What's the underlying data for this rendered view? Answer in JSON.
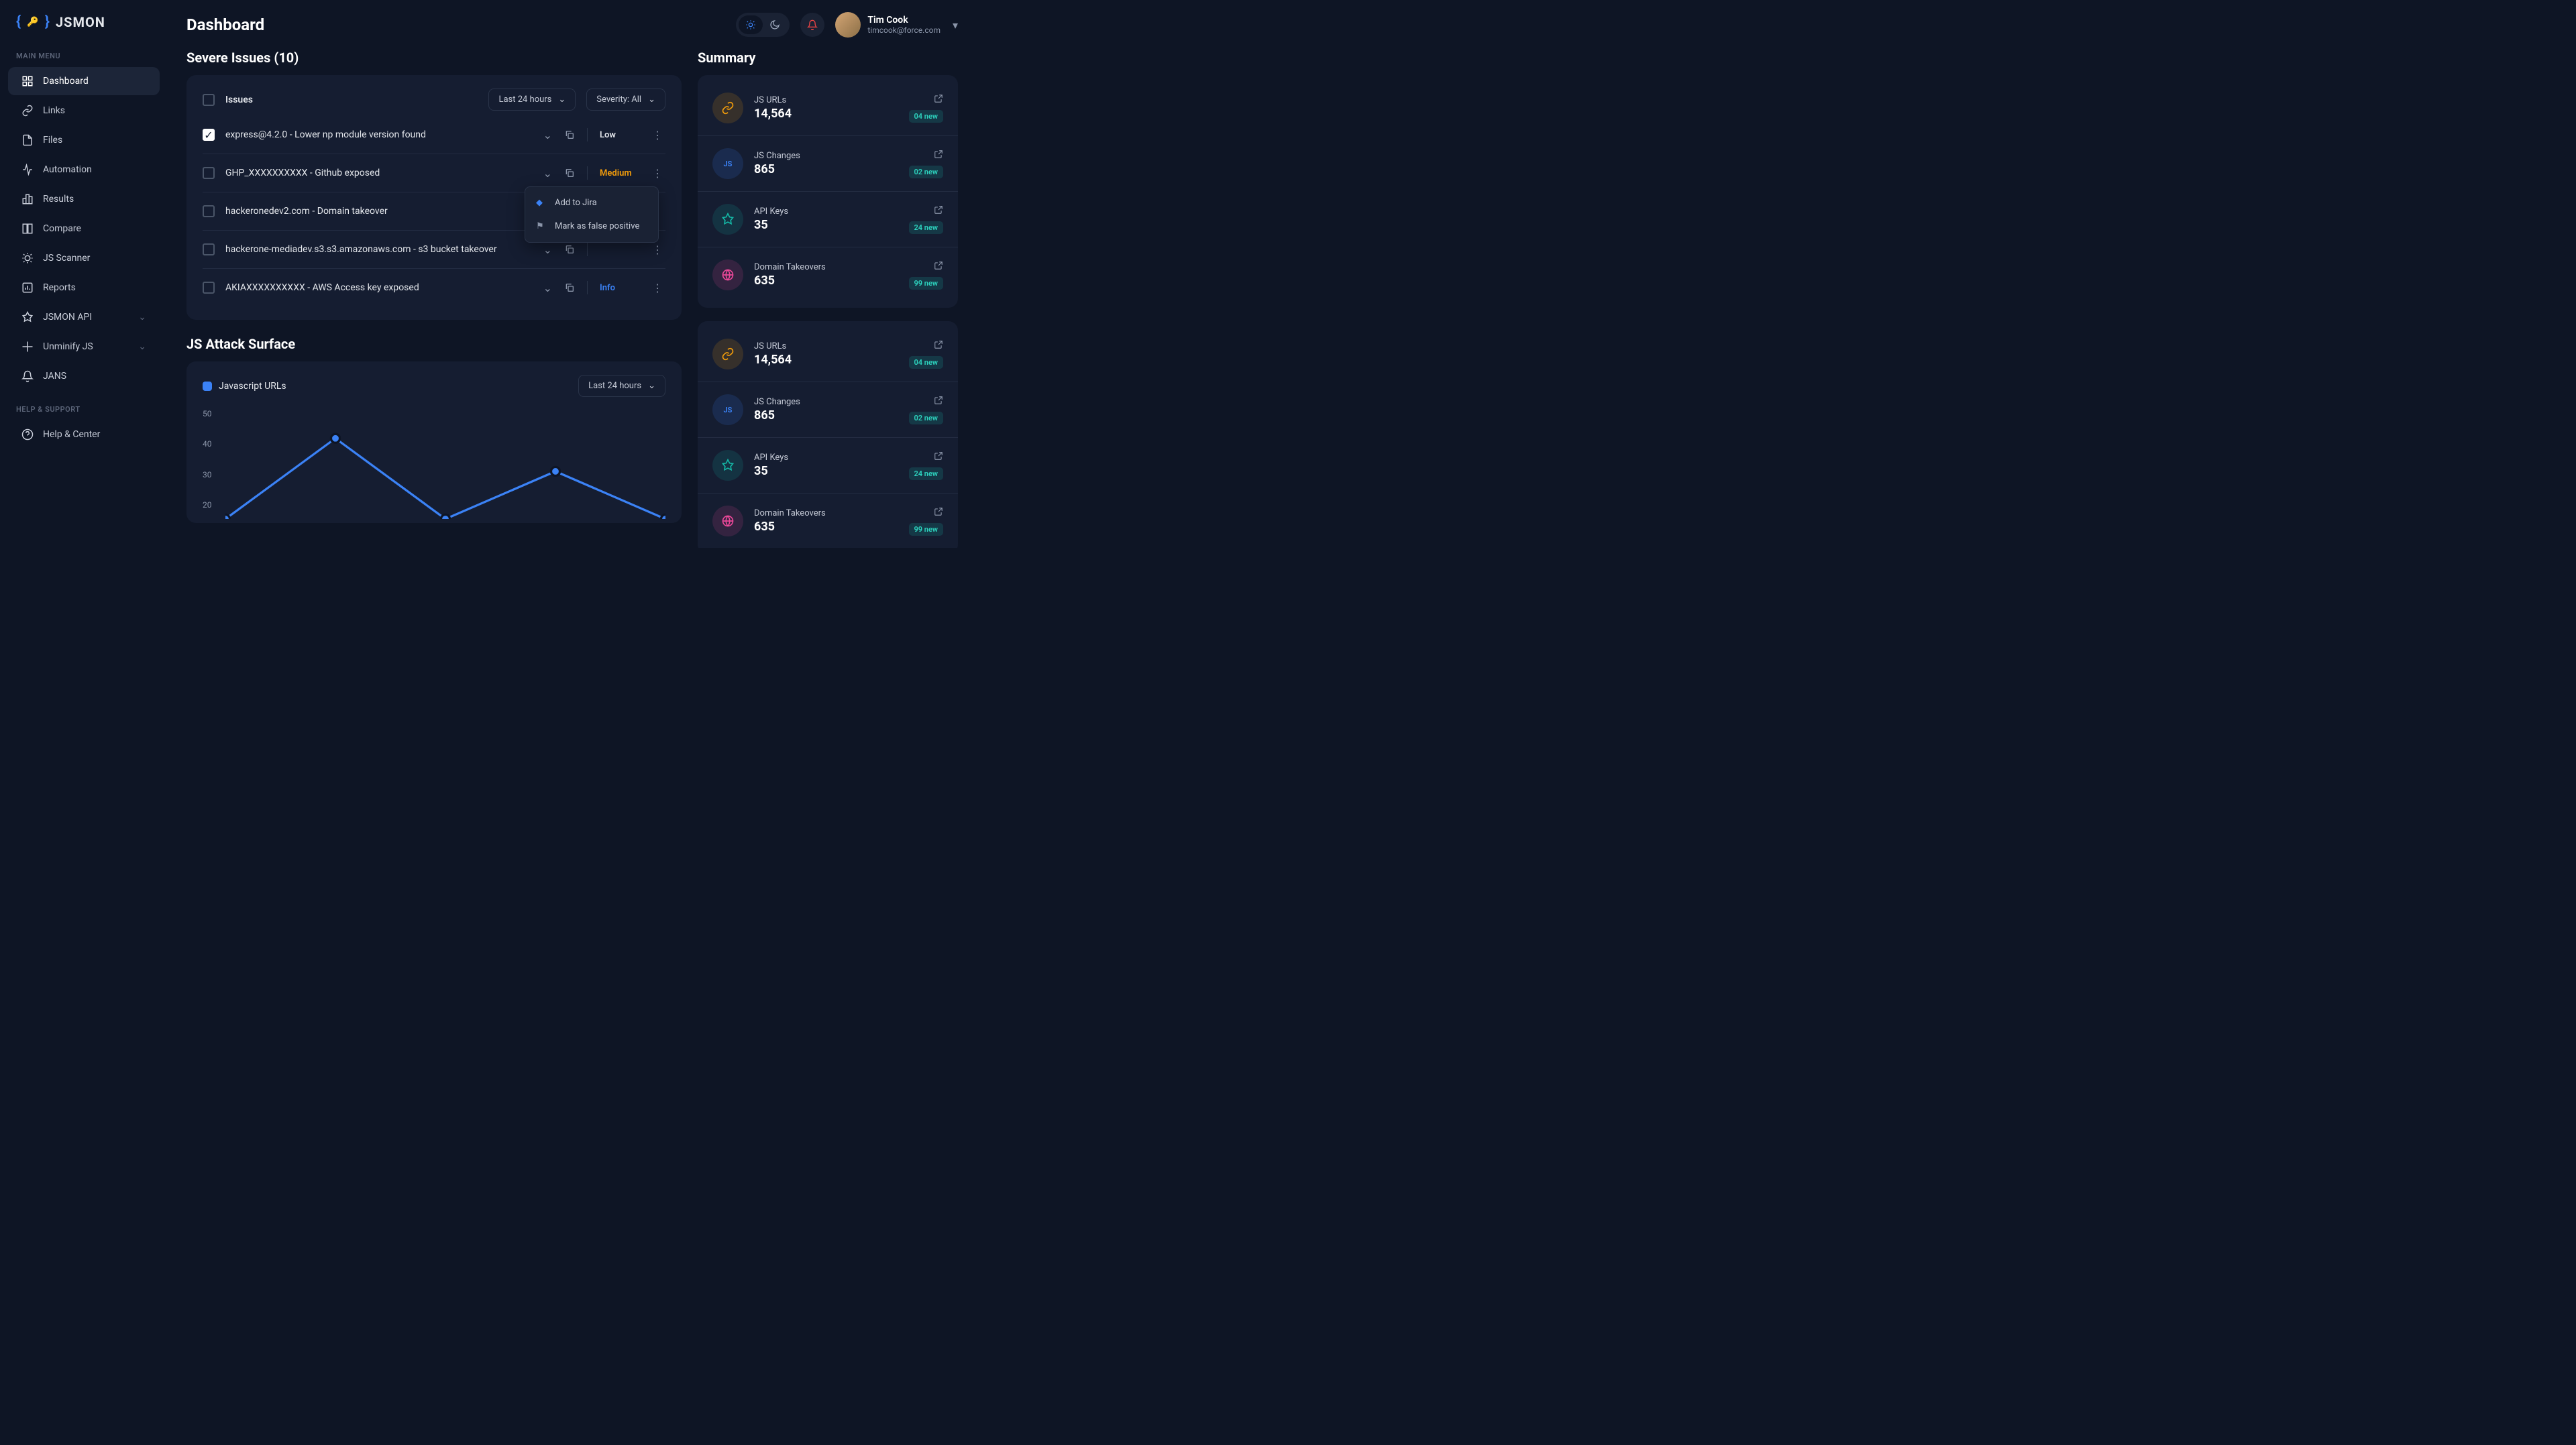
{
  "brand": "JSMON",
  "page_title": "Dashboard",
  "user": {
    "name": "Tim Cook",
    "email": "timcook@force.com"
  },
  "sidebar": {
    "main_label": "MAIN MENU",
    "help_label": "HELP & SUPPORT",
    "items": [
      {
        "label": "Dashboard"
      },
      {
        "label": "Links"
      },
      {
        "label": "Files"
      },
      {
        "label": "Automation"
      },
      {
        "label": "Results"
      },
      {
        "label": "Compare"
      },
      {
        "label": "JS Scanner"
      },
      {
        "label": "Reports"
      },
      {
        "label": "JSMON API"
      },
      {
        "label": "Unminify JS"
      },
      {
        "label": "JANS"
      }
    ],
    "help_item": {
      "label": "Help & Center"
    }
  },
  "issues": {
    "title": "Severe Issues (10)",
    "header_label": "Issues",
    "filter_time": "Last 24 hours",
    "filter_severity": "Severity: All",
    "rows": [
      {
        "title": "express@4.2.0 - Lower np module version found",
        "severity": "Low",
        "sev_class": "sev-low",
        "checked": true
      },
      {
        "title": "GHP_XXXXXXXXXX - Github exposed",
        "severity": "Medium",
        "sev_class": "sev-medium",
        "checked": false
      },
      {
        "title": "hackeronedev2.com - Domain takeover",
        "severity": "",
        "sev_class": "",
        "checked": false
      },
      {
        "title": "hackerone-mediadev.s3.s3.amazonaws.com - s3 bucket takeover",
        "severity": "",
        "sev_class": "",
        "checked": false
      },
      {
        "title": "AKIAXXXXXXXXXX - AWS Access key exposed",
        "severity": "Info",
        "sev_class": "sev-info",
        "checked": false
      }
    ],
    "popup": {
      "jira": "Add to Jira",
      "false_positive": "Mark as false positive"
    }
  },
  "attack": {
    "title": "JS Attack Surface",
    "legend": "Javascript URLs",
    "filter": "Last 24 hours"
  },
  "summary": {
    "title": "Summary",
    "groups": [
      [
        {
          "label": "JS URLs",
          "value": "14,564",
          "badge": "04 new",
          "icon": "link"
        },
        {
          "label": "JS Changes",
          "value": "865",
          "badge": "02 new",
          "icon": "js"
        },
        {
          "label": "API Keys",
          "value": "35",
          "badge": "24 new",
          "icon": "api"
        },
        {
          "label": "Domain Takeovers",
          "value": "635",
          "badge": "99 new",
          "icon": "dom"
        }
      ],
      [
        {
          "label": "JS URLs",
          "value": "14,564",
          "badge": "04 new",
          "icon": "link"
        },
        {
          "label": "JS Changes",
          "value": "865",
          "badge": "02 new",
          "icon": "js"
        },
        {
          "label": "API Keys",
          "value": "35",
          "badge": "24 new",
          "icon": "api"
        },
        {
          "label": "Domain Takeovers",
          "value": "635",
          "badge": "99 new",
          "icon": "dom"
        }
      ]
    ]
  },
  "chart_data": {
    "type": "line",
    "title": "JS Attack Surface",
    "ylabel": "",
    "xlabel": "",
    "ylim": [
      20,
      50
    ],
    "y_ticks": [
      50,
      40,
      30,
      20
    ],
    "series": [
      {
        "name": "Javascript URLs",
        "values": [
          20,
          42,
          20,
          33,
          20
        ]
      }
    ]
  }
}
